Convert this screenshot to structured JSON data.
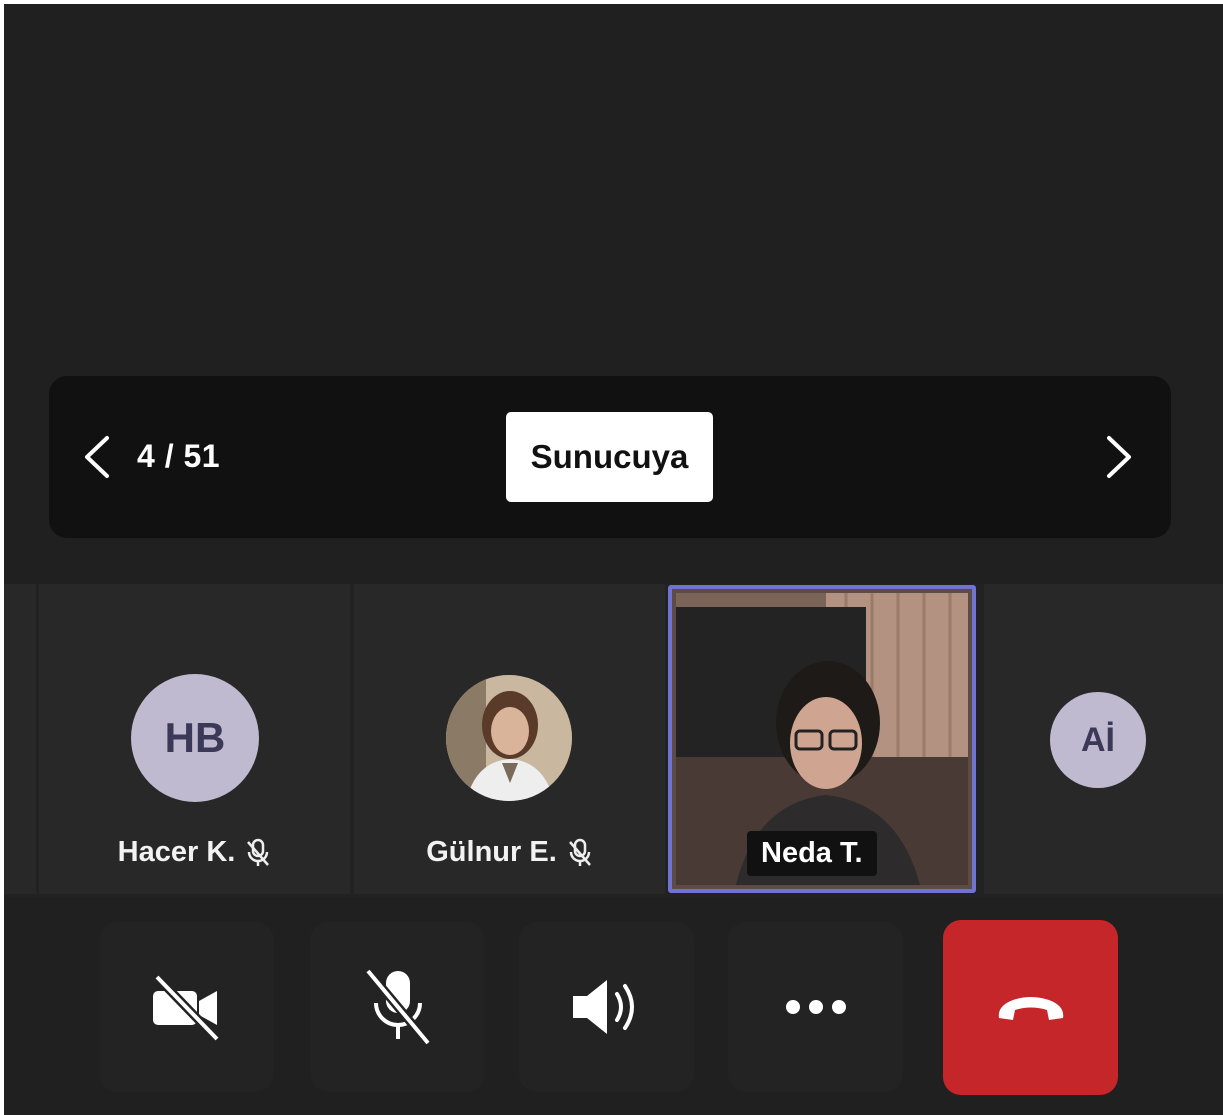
{
  "presentation": {
    "page_counter": "4 / 51",
    "present_button_label": "Sunucuya"
  },
  "participants": [
    {
      "initials": "HB",
      "name": "Hacer K.",
      "muted": true
    },
    {
      "initials": "",
      "name": "Gülnur E.",
      "muted": true,
      "has_photo": true
    },
    {
      "name": "Neda T.",
      "active_speaker": true,
      "video_on": true
    },
    {
      "initials": "Aİ",
      "name": ""
    }
  ],
  "controls": {
    "camera_icon": "video-off-icon",
    "mic_icon": "mic-off-icon",
    "speaker_icon": "speaker-volume-icon",
    "more_icon": "more-horizontal-icon",
    "hangup_icon": "hang-up-icon"
  },
  "colors": {
    "background": "#202020",
    "nav_bar": "#111111",
    "avatar_bg": "#bfbad0",
    "avatar_text": "#3c3857",
    "active_border": "#7173d0",
    "hangup": "#c4262a"
  }
}
